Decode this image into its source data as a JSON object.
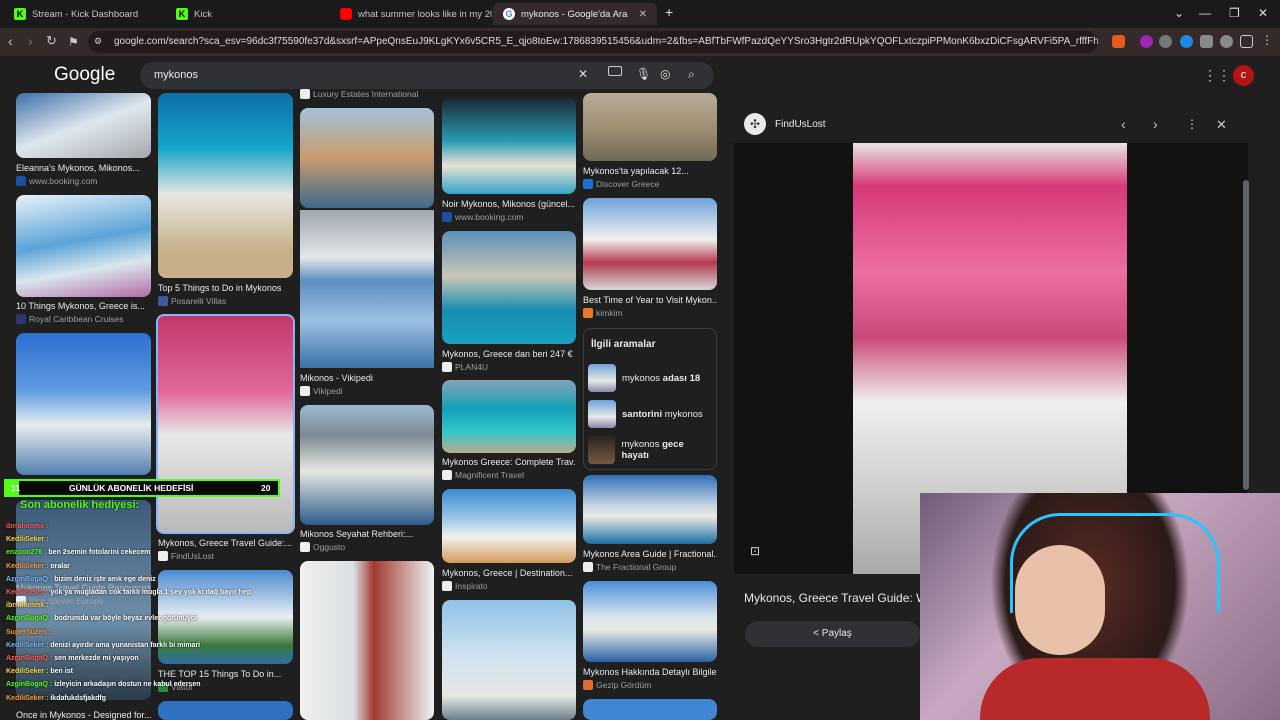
{
  "tabs": [
    {
      "label": "Stream - Kick Dashboard",
      "icon": "kick-icon"
    },
    {
      "label": "Kick",
      "icon": "kick-icon"
    },
    {
      "label": "what summer looks like in my 20s - Y",
      "icon": "youtube-icon"
    },
    {
      "label": "mykonos - Google'da Ara",
      "icon": "google-icon",
      "active": true
    }
  ],
  "address": "google.com/search?sca_esv=96dc3f75590fe37d&sxsrf=APpeQnsEuJ9KLgKYx6v5CR5_E_qjo8toEw:1786839515456&udm=2&fbs=ABfTbFWfPazdQeYYSro3Hgtr2dRUpkYQOFLxtczpiPPMonK6bxzDiCFsgARVFi5PA_rfffFh0YVZYIKOkKt9HP363K...",
  "google": {
    "logo": "Google",
    "query": "mykonos",
    "avatar_letter": "c"
  },
  "results": {
    "col1": [
      {
        "title": "Eleanna's Mykonos, Mikonos...",
        "source": "www.booking.com"
      },
      {
        "title": "10 Things Mykonos, Greece is...",
        "source": "Royal Caribbean Cruises"
      },
      {
        "title": "Mykonos Travel Guide Resources...",
        "source": "Rick Steves Europe"
      },
      {
        "title": "Once in Mykonos - Designed for...",
        "source": ""
      }
    ],
    "col2": [
      {
        "title": "Top 5 Things to Do in Mykonos",
        "source": "Posarelli Villas"
      },
      {
        "title": "Mykonos, Greece Travel Guide:...",
        "source": "FindUsLost"
      },
      {
        "title": "THE TOP 15 Things To Do in...",
        "source": "Viator"
      }
    ],
    "col3": [
      {
        "title": "",
        "source": "Luxury Estates International"
      },
      {
        "title": "Mikonos - Vikipedi",
        "source": "Vikipedi"
      },
      {
        "title": "Mikonos Seyahat Rehberi:...",
        "source": "Oggusto"
      }
    ],
    "col4": [
      {
        "title": "Noir Mykonos, Mikonos (güncel...",
        "source": "www.booking.com"
      },
      {
        "title": "Mykonos, Greece dan beri 247 €",
        "source": "PLAN4U"
      },
      {
        "title": "Mykonos Greece: Complete Trav...",
        "source": "Magnificent Travel"
      },
      {
        "title": "Mykonos, Greece | Destination...",
        "source": "Inspirato"
      }
    ],
    "col5": [
      {
        "title": "Mykonos'ta yapılacak 12...",
        "source": "Discover Greece"
      },
      {
        "title": "Best Time of Year to Visit Mykon...",
        "source": "kimkim"
      },
      {
        "title": "Mykonos Area Guide | Fractional...",
        "source": "The Fractional Group"
      },
      {
        "title": "Mykonos Hakkında Detaylı Bilgile...",
        "source": "Gezip Gördüm"
      }
    ]
  },
  "related": {
    "heading": "İlgili aramalar",
    "items": [
      {
        "pre": "mykonos ",
        "bold": "adası 18"
      },
      {
        "pre": "",
        "bold": "santorini",
        "post": " mykonos"
      },
      {
        "pre": "mykonos ",
        "bold": "gece hayatı"
      }
    ]
  },
  "preview": {
    "site": "FindUsLost",
    "title": "Mykonos, Greece Travel Guide: W",
    "share": "Paylaş"
  },
  "overlay": {
    "goal_label": "GÜNLÜK ABONELİK HEDEFİSİ",
    "goal_current": "11",
    "goal_target": "20",
    "last_sub": "Son abonelik hediyesi:",
    "chat": [
      {
        "user": "ibrrahimmk",
        "msg": ""
      },
      {
        "user": "KediliSeker",
        "msg": ""
      },
      {
        "user": "enzooo276",
        "msg": "ben 2semin fotolarini cekecem"
      },
      {
        "user": "KediliSeker",
        "msg": "oralar"
      },
      {
        "user": "AzginBogaQ",
        "msg": "bizim deniz işte amk ege deniz"
      },
      {
        "user": "KediliSeker",
        "msg": "yok ya mugladan cok farklı mugla 1 şey yok ki dağ bayır hep"
      },
      {
        "user": "ibrrahimmk",
        "msg": ""
      },
      {
        "user": "AzginBogaQ",
        "msg": "bodrumda var böyle beyaz evler görünüyor"
      },
      {
        "user": "SuperSuzen",
        "msg": ""
      },
      {
        "user": "KediliSeker",
        "msg": "denizi ayırdır ama yunanistan farklı bi mimari"
      },
      {
        "user": "AzginBogaQ",
        "msg": "sen merkezde mi yaşıyon"
      },
      {
        "user": "KediliSeker",
        "msg": "ben ist"
      },
      {
        "user": "AzginBogaQ",
        "msg": "izleyicin arkadaşın dostun ne kabul edersen"
      },
      {
        "user": "KediliSeker",
        "msg": "ikdafukdsfjakdfg"
      }
    ]
  },
  "colors": {
    "tab_bg": "#1a1a1a",
    "toolbar": "#352a2a",
    "page_bg": "#1f1f1f",
    "kick_green": "#53fc18",
    "avatar": "#b31412"
  }
}
